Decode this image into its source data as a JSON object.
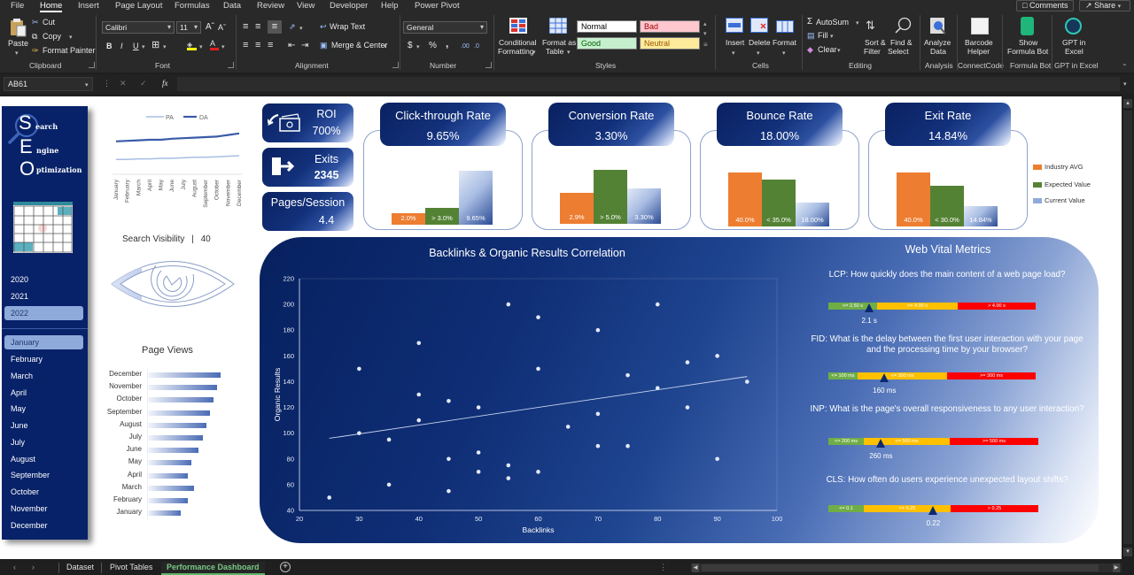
{
  "ribbon": {
    "tabs": [
      {
        "label": "File"
      },
      {
        "label": "Home"
      },
      {
        "label": "Insert"
      },
      {
        "label": "Page Layout"
      },
      {
        "label": "Formulas"
      },
      {
        "label": "Data"
      },
      {
        "label": "Review"
      },
      {
        "label": "View"
      },
      {
        "label": "Developer"
      },
      {
        "label": "Help"
      },
      {
        "label": "Power Pivot"
      }
    ],
    "active_tab": "Home",
    "comments_label": "Comments",
    "share_label": "Share",
    "clipboard": {
      "paste": "Paste",
      "cut": "Cut",
      "copy": "Copy",
      "format_painter": "Format Painter",
      "group": "Clipboard"
    },
    "font": {
      "name": "Calibri",
      "size": "11",
      "bold": "B",
      "italic": "I",
      "underline": "U",
      "group": "Font"
    },
    "alignment": {
      "wrap": "Wrap Text",
      "merge": "Merge & Center",
      "group": "Alignment"
    },
    "number": {
      "format": "General",
      "currency": "$",
      "percent": "%",
      "comma": ",",
      "group": "Number"
    },
    "styles": {
      "conditional": [
        "Conditional",
        "Formatting"
      ],
      "format_table": [
        "Format as",
        "Table"
      ],
      "cells": [
        {
          "label": "Normal",
          "bg": "#ffffff",
          "fg": "#000000"
        },
        {
          "label": "Bad",
          "bg": "#ffc7ce",
          "fg": "#9c0006"
        },
        {
          "label": "Good",
          "bg": "#c6efce",
          "fg": "#006100"
        },
        {
          "label": "Neutral",
          "bg": "#ffeb9c",
          "fg": "#9c5700"
        }
      ],
      "group": "Styles"
    },
    "cells": {
      "insert": "Insert",
      "delete": "Delete",
      "format": "Format",
      "group": "Cells"
    },
    "editing": {
      "autosum": "AutoSum",
      "fill": "Fill",
      "clear": "Clear",
      "sort": [
        "Sort &",
        "Filter"
      ],
      "find": [
        "Find &",
        "Select"
      ],
      "group": "Editing"
    },
    "addins": [
      {
        "label": [
          "Analyze",
          "Data"
        ],
        "group": "Analysis"
      },
      {
        "label": [
          "Barcode",
          "Helper"
        ],
        "group": "ConnectCode"
      },
      {
        "label": [
          "Show",
          "Formula Bot"
        ],
        "group": "Formula Bot"
      },
      {
        "label": [
          "GPT in",
          "Excel"
        ],
        "group": "GPT in Excel"
      }
    ]
  },
  "formula_bar": {
    "name_box": "AB61",
    "fx": "fx",
    "value": ""
  },
  "sidebar": {
    "logo": {
      "letters": [
        "S",
        "E",
        "O"
      ],
      "words": [
        "earch",
        "ngine",
        "ptimization"
      ]
    },
    "years": [
      {
        "label": "2020",
        "selected": false
      },
      {
        "label": "2021",
        "selected": false
      },
      {
        "label": "2022",
        "selected": true
      }
    ],
    "months": [
      {
        "label": "January",
        "selected": true
      },
      {
        "label": "February",
        "selected": false
      },
      {
        "label": "March",
        "selected": false
      },
      {
        "label": "April",
        "selected": false
      },
      {
        "label": "May",
        "selected": false
      },
      {
        "label": "June",
        "selected": false
      },
      {
        "label": "July",
        "selected": false
      },
      {
        "label": "August",
        "selected": false
      },
      {
        "label": "September",
        "selected": false
      },
      {
        "label": "October",
        "selected": false
      },
      {
        "label": "November",
        "selected": false
      },
      {
        "label": "December",
        "selected": false
      }
    ]
  },
  "search_visibility": {
    "label": "Search Visibility",
    "separator": "|",
    "value": "40"
  },
  "kpi_cards": [
    {
      "title": "ROI",
      "value": "700%",
      "icon": "cash-back-icon"
    },
    {
      "title": "Exits",
      "value": "2345",
      "icon": "exit-door-icon"
    },
    {
      "title": "Pages/Session",
      "value": "4.4"
    }
  ],
  "web_vitals": {
    "title": "Web Vital Metrics",
    "metrics": [
      {
        "name": "LCP",
        "question": "LCP: How quickly does the main content of a web page load?",
        "segments": [
          "<= 2.50 s",
          "<= 4.00 s",
          "> 4.00 s"
        ],
        "thresholds": [
          2.5,
          4.0
        ],
        "value": 2.1,
        "value_label": "2.1 s"
      },
      {
        "name": "FID",
        "question": "FID: What is the delay between the first user interaction with your page and the processing time by your browser?",
        "segments": [
          "<= 100 ms",
          "<= 300 ms",
          ">= 300 ms"
        ],
        "thresholds": [
          100,
          300
        ],
        "value": 160,
        "value_label": "160 ms"
      },
      {
        "name": "INP",
        "question": "INP: What is the page's overall responsiveness to any user interaction?",
        "segments": [
          "<= 200 ms",
          "<= 500 ms",
          ">= 500 ms"
        ],
        "thresholds": [
          200,
          500
        ],
        "value": 260,
        "value_label": "260 ms"
      },
      {
        "name": "CLS",
        "question": "CLS:  How often do users experience unexpected layout shifts?",
        "segments": [
          "<= 0.1",
          "<= 0.25",
          "> 0.25"
        ],
        "thresholds": [
          0.1,
          0.25
        ],
        "value": 0.22,
        "value_label": "0.22"
      }
    ]
  },
  "sheet_tabs": {
    "tabs": [
      {
        "label": "Dataset"
      },
      {
        "label": "Pivot Tables"
      },
      {
        "label": "Performance Dashboard"
      }
    ],
    "active": "Performance Dashboard"
  },
  "colors": {
    "navy": "#072269",
    "industry": "#ed7d31",
    "expected": "#548235",
    "current": "#8faadc",
    "good": "#70ad47",
    "needs_improvement": "#ffc000",
    "poor": "#ff0000",
    "pa_line": "#a9bde3",
    "da_line": "#3a5ba8",
    "active_sheet_tab": "#78c884"
  },
  "chart_data": [
    {
      "id": "pa-da",
      "type": "line",
      "title": "",
      "xlabel": "",
      "ylabel": "",
      "categories": [
        "January",
        "February",
        "March",
        "April",
        "May",
        "June",
        "July",
        "August",
        "September",
        "October",
        "November",
        "December"
      ],
      "series": [
        {
          "name": "PA",
          "values": [
            28,
            28,
            29,
            29,
            30,
            30,
            31,
            32,
            32,
            33,
            34,
            35
          ]
        },
        {
          "name": "DA",
          "values": [
            62,
            63,
            64,
            65,
            65,
            67,
            68,
            69,
            70,
            71,
            74,
            77
          ]
        }
      ],
      "ylim": [
        0,
        100
      ],
      "legend": "top",
      "grid": false
    },
    {
      "id": "page-views",
      "type": "bar",
      "orientation": "horizontal",
      "title": "Page Views",
      "categories": [
        "December",
        "November",
        "October",
        "September",
        "August",
        "July",
        "June",
        "May",
        "April",
        "March",
        "February",
        "January"
      ],
      "values": [
        100,
        95,
        90,
        85,
        80,
        75,
        70,
        60,
        55,
        63,
        55,
        45
      ],
      "units": "relative to max (no axis shown)"
    },
    {
      "id": "ctr",
      "type": "bar",
      "title": "Click-through Rate",
      "headline": "9.65%",
      "categories": [
        "Industry AVG",
        "Expected Value",
        "Current Value"
      ],
      "values": [
        2.0,
        3.0,
        9.65
      ],
      "labels": [
        "2.0%",
        "> 3.0%",
        "9.65%"
      ],
      "legend": "right"
    },
    {
      "id": "conversion",
      "type": "bar",
      "title": "Conversion Rate",
      "headline": "3.30%",
      "categories": [
        "Industry AVG",
        "Expected Value",
        "Current Value"
      ],
      "values": [
        2.9,
        5.0,
        3.3
      ],
      "labels": [
        "2.9%",
        "> 5.0%",
        "3.30%"
      ]
    },
    {
      "id": "bounce",
      "type": "bar",
      "title": "Bounce Rate",
      "headline": "18.00%",
      "categories": [
        "Industry AVG",
        "Expected Value",
        "Current Value"
      ],
      "values": [
        40.0,
        35.0,
        18.0
      ],
      "labels": [
        "40.0%",
        "< 35.0%",
        "18.00%"
      ]
    },
    {
      "id": "exit",
      "type": "bar",
      "title": "Exit Rate",
      "headline": "14.84%",
      "categories": [
        "Industry AVG",
        "Expected Value",
        "Current Value"
      ],
      "values": [
        40.0,
        30.0,
        14.84
      ],
      "labels": [
        "40.0%",
        "< 30.0%",
        "14.84%"
      ]
    },
    {
      "id": "backlinks-organic",
      "type": "scatter",
      "title": "Backlinks & Organic Results Correlation",
      "xlabel": "Backlinks",
      "ylabel": "Organic Results",
      "xlim": [
        20,
        100
      ],
      "ylim": [
        40,
        220
      ],
      "xticks": [
        20,
        30,
        40,
        50,
        60,
        70,
        80,
        90,
        100
      ],
      "yticks": [
        40,
        60,
        80,
        100,
        120,
        140,
        160,
        180,
        200,
        220
      ],
      "points": [
        [
          25,
          50
        ],
        [
          30,
          150
        ],
        [
          30,
          100
        ],
        [
          35,
          95
        ],
        [
          35,
          60
        ],
        [
          40,
          170
        ],
        [
          40,
          130
        ],
        [
          40,
          110
        ],
        [
          45,
          125
        ],
        [
          45,
          80
        ],
        [
          45,
          55
        ],
        [
          50,
          120
        ],
        [
          50,
          85
        ],
        [
          50,
          70
        ],
        [
          55,
          200
        ],
        [
          55,
          75
        ],
        [
          55,
          65
        ],
        [
          60,
          190
        ],
        [
          60,
          150
        ],
        [
          60,
          70
        ],
        [
          65,
          105
        ],
        [
          70,
          180
        ],
        [
          70,
          115
        ],
        [
          70,
          90
        ],
        [
          75,
          145
        ],
        [
          75,
          90
        ],
        [
          80,
          200
        ],
        [
          80,
          135
        ],
        [
          85,
          155
        ],
        [
          85,
          120
        ],
        [
          90,
          160
        ],
        [
          90,
          80
        ],
        [
          95,
          140
        ]
      ],
      "trendline": {
        "type": "linear",
        "from": [
          25,
          96
        ],
        "to": [
          95,
          144
        ]
      },
      "grid": false
    }
  ]
}
